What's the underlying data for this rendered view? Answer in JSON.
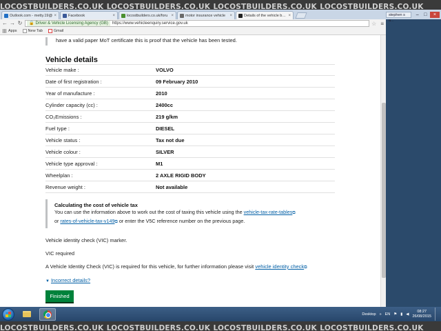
{
  "watermark": {
    "text": "LOCOSTBUILDERS.CO.UK"
  },
  "browser": {
    "tabs": [
      {
        "label": "Outlook.com - metty.19@",
        "color": "#1f6fc5"
      },
      {
        "label": "Facebook",
        "color": "#3b5998"
      },
      {
        "label": "locostbuilders.co.uk/foru",
        "color": "#4a8f2f"
      },
      {
        "label": "motor insurance vehicle",
        "color": "#6a6a6a"
      },
      {
        "label": "Details of the vehicle bein",
        "color": "#222222",
        "active": true
      }
    ],
    "user_chip": "stephen s a...",
    "security_label": "Driver & Vehicle Licensing Agency (GB)",
    "url": "https://www.vehicleenquiry.service.gov.uk",
    "bookmarks": [
      {
        "label": "Apps",
        "icon": "apps-grid-icon"
      },
      {
        "label": "New Tab",
        "icon": "page-icon"
      },
      {
        "label": "Gmail",
        "icon": "gmail-icon"
      }
    ]
  },
  "page": {
    "intro_text": "have a valid paper MoT certificate this is proof that the vehicle has been tested.",
    "heading": "Vehicle details",
    "details": [
      {
        "key": "Vehicle make :",
        "value": "VOLVO"
      },
      {
        "key": "Date of first registration :",
        "value": "09 February 2010"
      },
      {
        "key": "Year of manufacture :",
        "value": "2010"
      },
      {
        "key": "Cylinder capacity (cc) :",
        "value": "2400cc"
      },
      {
        "key": "CO₂Emissions :",
        "value": "219 g/km"
      },
      {
        "key": "Fuel type :",
        "value": "DIESEL"
      },
      {
        "key": "Vehicle status :",
        "value": "Tax not due"
      },
      {
        "key": "Vehicle colour :",
        "value": "SILVER"
      },
      {
        "key": "Vehicle type approval :",
        "value": "M1"
      },
      {
        "key": "Wheelplan :",
        "value": "2 AXLE RIGID BODY"
      },
      {
        "key": "Revenue weight :",
        "value": "Not available"
      }
    ],
    "tax_panel": {
      "heading": "Calculating the cost of vehicle tax",
      "text_1": "You can use the information above to work out the cost of taxing this vehicle using the",
      "link_1": "vehicle-tax-rate-tables",
      "text_2": "or",
      "link_2": "rates-of-vehicle-tax-v149",
      "text_3": "or enter the V5C reference number on the previous page."
    },
    "vic_marker": "Vehicle identity check (VIC) marker.",
    "vic_required": "VIC required",
    "vic_text": "A Vehicle Identity Check (VIC) is required for this vehicle, for further information please visit",
    "vic_link": "vehicle identity check",
    "incorrect_details": "Incorrect details?",
    "finished_button": "Finished"
  },
  "taskbar": {
    "desktop_label": "Desktop",
    "language": "EN",
    "time": "08:27",
    "date": "26/08/2015"
  }
}
